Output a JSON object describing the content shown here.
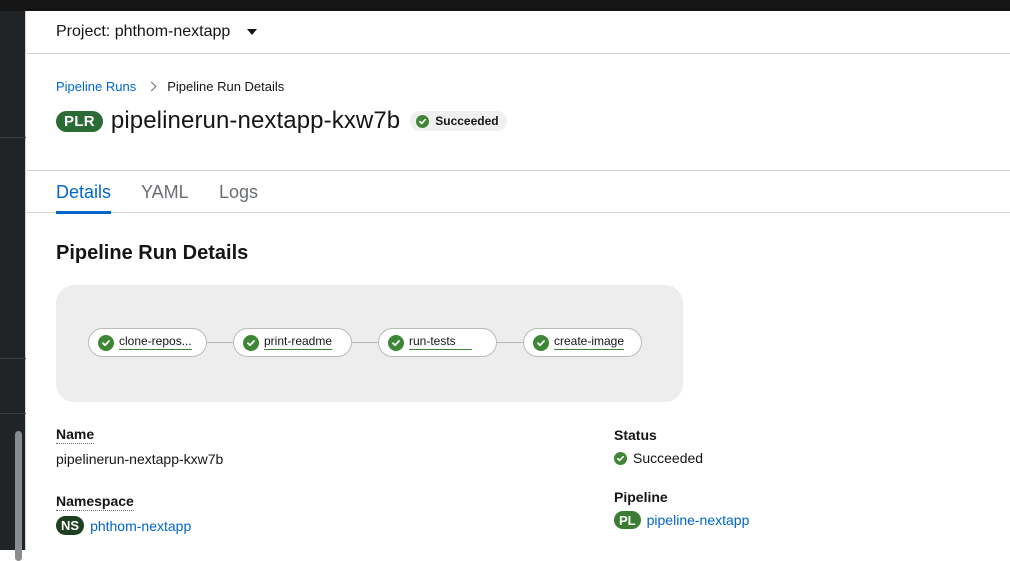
{
  "project": {
    "label": "Project: phthom-nextapp"
  },
  "breadcrumb": {
    "parent": "Pipeline Runs",
    "current": "Pipeline Run Details"
  },
  "header": {
    "badge": "PLR",
    "title": "pipelinerun-nextapp-kxw7b",
    "status": "Succeeded"
  },
  "tabs": [
    {
      "label": "Details",
      "active": true
    },
    {
      "label": "YAML",
      "active": false
    },
    {
      "label": "Logs",
      "active": false
    }
  ],
  "section": {
    "title": "Pipeline Run Details"
  },
  "tasks": [
    {
      "label": "clone-repos...",
      "status": "succeeded"
    },
    {
      "label": "print-readme",
      "status": "succeeded"
    },
    {
      "label": "run-tests",
      "status": "succeeded"
    },
    {
      "label": "create-image",
      "status": "succeeded"
    }
  ],
  "details": {
    "name_label": "Name",
    "name_value": "pipelinerun-nextapp-kxw7b",
    "namespace_label": "Namespace",
    "namespace_badge": "NS",
    "namespace_value": "phthom-nextapp",
    "status_label": "Status",
    "status_value": "Succeeded",
    "pipeline_label": "Pipeline",
    "pipeline_badge": "PL",
    "pipeline_value": "pipeline-nextapp"
  },
  "colors": {
    "link": "#0066cc",
    "success": "#3e8635",
    "resource_badge": "#2b6b36"
  },
  "icons": {
    "project_dropdown": "caret-down-icon",
    "breadcrumb_separator": "chevron-right-icon",
    "status": "check-circle-icon"
  }
}
